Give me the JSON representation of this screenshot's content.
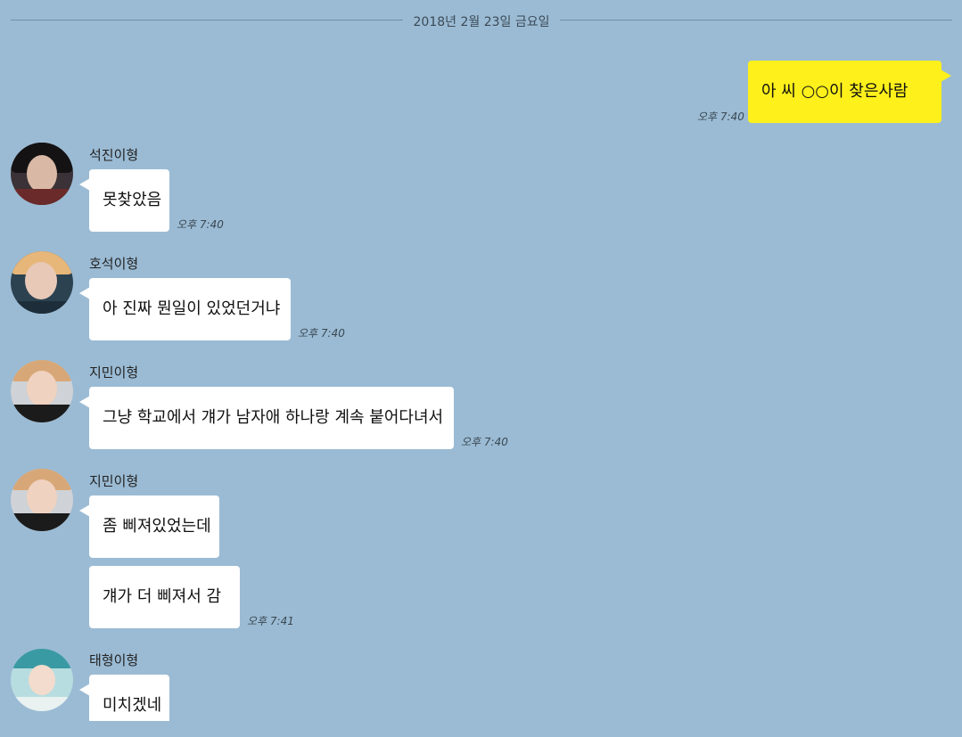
{
  "date_divider": "2018년 2월 23일 금요일",
  "messages": [
    {
      "sender": "me",
      "text": "아 씨 ○○이 찾은사람",
      "time": "오후 7:40"
    },
    {
      "sender": "석진이형",
      "text": "못찾았음",
      "time": "오후 7:40",
      "avatar": "profile-photo"
    },
    {
      "sender": "호석이형",
      "text": "아 진짜 뭔일이 있었던거냐",
      "time": "오후 7:40",
      "avatar": "profile-photo"
    },
    {
      "sender": "지민이형",
      "text": "그냥 학교에서 걔가 남자애 하나랑 계속 붙어다녀서",
      "time": "오후 7:40",
      "avatar": "profile-photo"
    },
    {
      "sender": "지민이형",
      "text": "좀 삐져있었는데",
      "avatar": "profile-photo"
    },
    {
      "sender": "지민이형",
      "text": "걔가 더 삐져서 감",
      "time": "오후 7:41"
    },
    {
      "sender": "태형이형",
      "text": "미치겠네",
      "avatar": "profile-photo"
    }
  ],
  "colors": {
    "background": "#9bbbd4",
    "my_bubble": "#fef01b",
    "other_bubble": "#ffffff"
  }
}
